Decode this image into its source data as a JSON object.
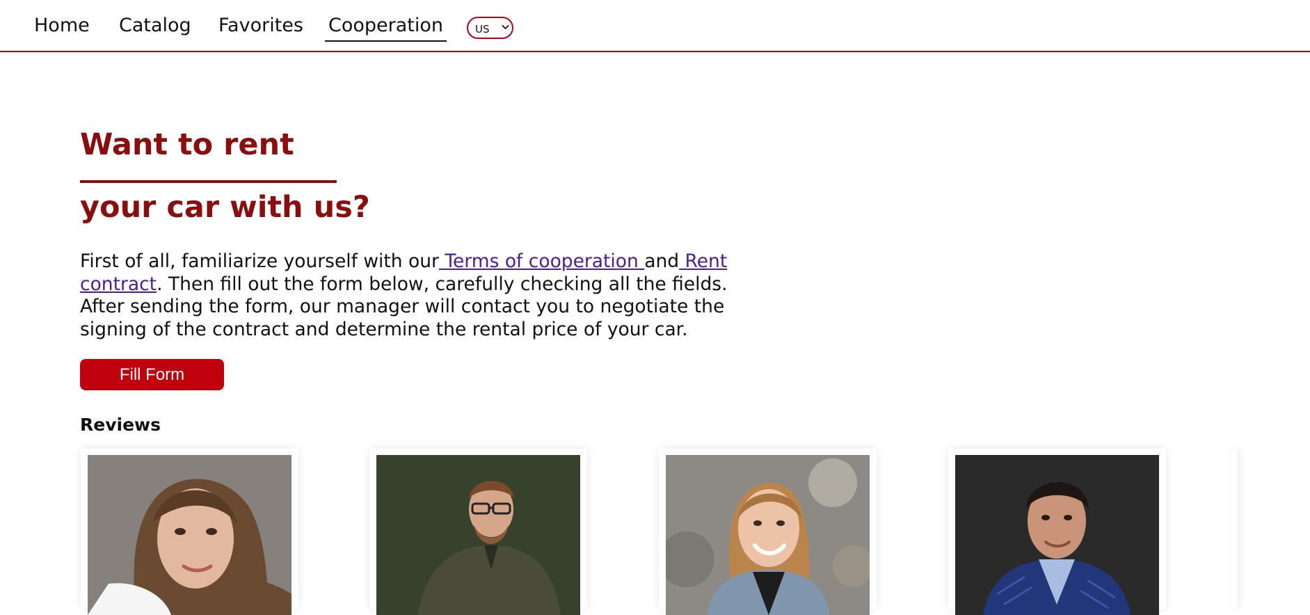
{
  "nav": {
    "items": [
      {
        "label": "Home",
        "active": false
      },
      {
        "label": "Catalog",
        "active": false
      },
      {
        "label": "Favorites",
        "active": false
      },
      {
        "label": "Cooperation",
        "active": true
      }
    ],
    "language": {
      "selected": "US",
      "icon": "chevron-down-icon"
    }
  },
  "hero": {
    "title_line1": "Want to rent",
    "title_line2": "your car with us?",
    "intro_before_link1": "First of all, familiarize yourself with our",
    "link1": " Terms of cooperation ",
    "intro_between": "and",
    "link2": " Rent contract",
    "intro_after": ". Then fill out the form below, carefully checking all the fields. After sending the form, our manager will contact you to negotiate the signing of the contract and determine the rental price of your car.",
    "button": "Fill Form"
  },
  "reviews": {
    "heading": "Reviews",
    "cards": [
      {
        "photo": "reviewer-woman-portrait"
      },
      {
        "photo": "reviewer-man-glasses-portrait"
      },
      {
        "photo": "reviewer-woman-smiling-portrait"
      },
      {
        "photo": "reviewer-man-blue-suit-portrait"
      }
    ]
  },
  "colors": {
    "accent": "#b50016",
    "title": "#8b0d0d",
    "link": "#4c1d95",
    "button": "#c1000e"
  }
}
